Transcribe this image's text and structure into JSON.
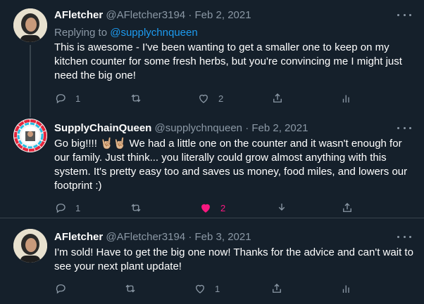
{
  "tweets": [
    {
      "name": "AFletcher",
      "handle": "@AFletcher3194",
      "sep": "·",
      "date": "Feb 2, 2021",
      "replying_prefix": "Replying to",
      "replying_handle": "@supplychnqueen",
      "text": "This is awesome - I've been wanting to get a smaller one to keep on my kitchen counter for some fresh herbs, but you're convincing me I might just need the big one!",
      "reply_count": "1",
      "retweet_count": "",
      "like_count": "2",
      "liked": false
    },
    {
      "name": "SupplyChainQueen",
      "handle": "@supplychnqueen",
      "sep": "·",
      "date": "Feb 2, 2021",
      "text": "Go big!!!! 🤘🏼🤘🏼 We had a little one on the counter and it wasn't enough for our family. Just think... you literally could grow almost anything with this system. It's pretty easy too and saves us money, food miles, and lowers our footprint :)",
      "reply_count": "1",
      "retweet_count": "",
      "like_count": "2",
      "liked": true
    },
    {
      "name": "AFletcher",
      "handle": "@AFletcher3194",
      "sep": "·",
      "date": "Feb 3, 2021",
      "text": "I'm sold! Have to get the big one now! Thanks for the advice  and can't wait to see your next plant update!",
      "reply_count": "",
      "retweet_count": "",
      "like_count": "1",
      "liked": false
    }
  ],
  "icons": {
    "reply": "reply-icon",
    "retweet": "retweet-icon",
    "like": "heart-icon",
    "share": "share-icon",
    "analytics": "analytics-icon",
    "more": "more-icon"
  },
  "colors": {
    "background": "#15202b",
    "text": "#ffffff",
    "muted": "#8b98a5",
    "link": "#1d9bf0",
    "like": "#f91880",
    "divider": "#38444d"
  }
}
